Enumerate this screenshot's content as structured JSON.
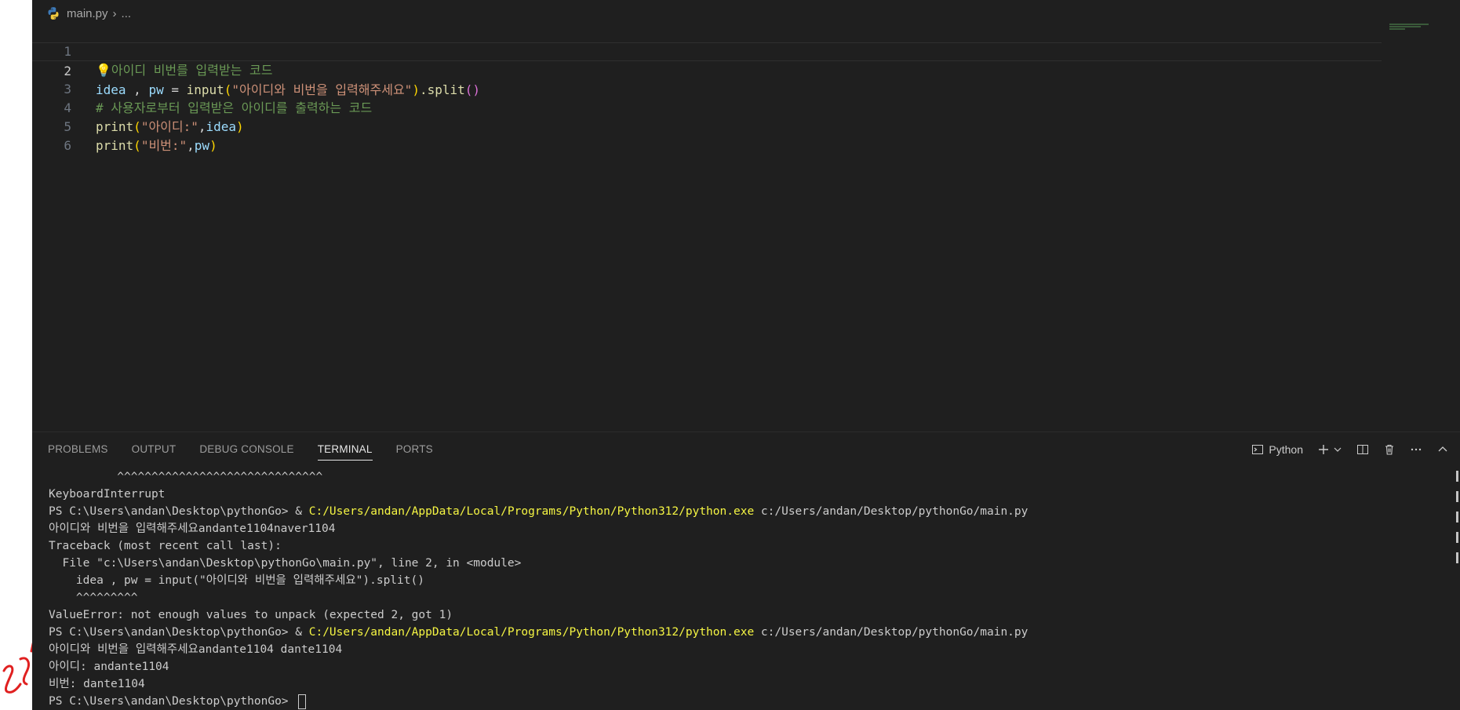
{
  "breadcrumb": {
    "file": "main.py",
    "rest": "..."
  },
  "editor": {
    "lines": [
      {
        "n": "1"
      },
      {
        "n": "2"
      },
      {
        "n": "3"
      },
      {
        "n": "4"
      },
      {
        "n": "5"
      },
      {
        "n": "6"
      }
    ],
    "code": {
      "l1_comment": "아이디 비번를 입력받는 코드",
      "l2_var1": "idea",
      "l2_sep": " , ",
      "l2_var2": "pw",
      "l2_eq": " = ",
      "l2_fn": "input",
      "l2_paren_open": "(",
      "l2_str": "\"아이디와 비번을 입력해주세요\"",
      "l2_paren_close": ")",
      "l2_method": ".split",
      "l2_call": "()",
      "l3_comment": "# 사용자로부터 입력받은 아이디를 출력하는 코드",
      "l4_fn": "print",
      "l4_open": "(",
      "l4_str": "\"아이디:\"",
      "l4_comma": ",",
      "l4_var": "idea",
      "l4_close": ")",
      "l5_fn": "print",
      "l5_open": "(",
      "l5_str": "\"비번:\"",
      "l5_comma": ",",
      "l5_var": "pw",
      "l5_close": ")"
    }
  },
  "panel": {
    "tabs": [
      "PROBLEMS",
      "OUTPUT",
      "DEBUG CONSOLE",
      "TERMINAL",
      "PORTS"
    ],
    "active_tab": "TERMINAL",
    "shell_label": "Python"
  },
  "terminal": {
    "lines": [
      {
        "text": "          ^^^^^^^^^^^^^^^^^^^^^^^^^^^^^^"
      },
      {
        "text": "KeyboardInterrupt"
      },
      {
        "prefix": "PS C:\\Users\\andan\\Desktop\\pythonGo> & ",
        "exe": "C:/Users/andan/AppData/Local/Programs/Python/Python312/python.exe",
        "suffix": " c:/Users/andan/Desktop/pythonGo/main.py"
      },
      {
        "text": "아이디와 비번을 입력해주세요andante1104naver1104"
      },
      {
        "text": "Traceback (most recent call last):"
      },
      {
        "text": "  File \"c:\\Users\\andan\\Desktop\\pythonGo\\main.py\", line 2, in <module>"
      },
      {
        "text": "    idea , pw = input(\"아이디와 비번을 입력해주세요\").split()"
      },
      {
        "text": "    ^^^^^^^^^"
      },
      {
        "text": "ValueError: not enough values to unpack (expected 2, got 1)"
      },
      {
        "prefix": "PS C:\\Users\\andan\\Desktop\\pythonGo> & ",
        "exe": "C:/Users/andan/AppData/Local/Programs/Python/Python312/python.exe",
        "suffix": " c:/Users/andan/Desktop/pythonGo/main.py"
      },
      {
        "text": "아이디와 비번을 입력해주세요andante1104 dante1104"
      },
      {
        "text": "아이디: andante1104"
      },
      {
        "text": "비번: dante1104"
      },
      {
        "text": "PS C:\\Users\\andan\\Desktop\\pythonGo> "
      }
    ]
  },
  "colors": {
    "editor_bg": "#1f1f1f",
    "comment": "#6a9955",
    "string": "#ce9178",
    "variable": "#9cdcfe",
    "function": "#dcdcaa",
    "terminal_exe": "#f5f543"
  }
}
